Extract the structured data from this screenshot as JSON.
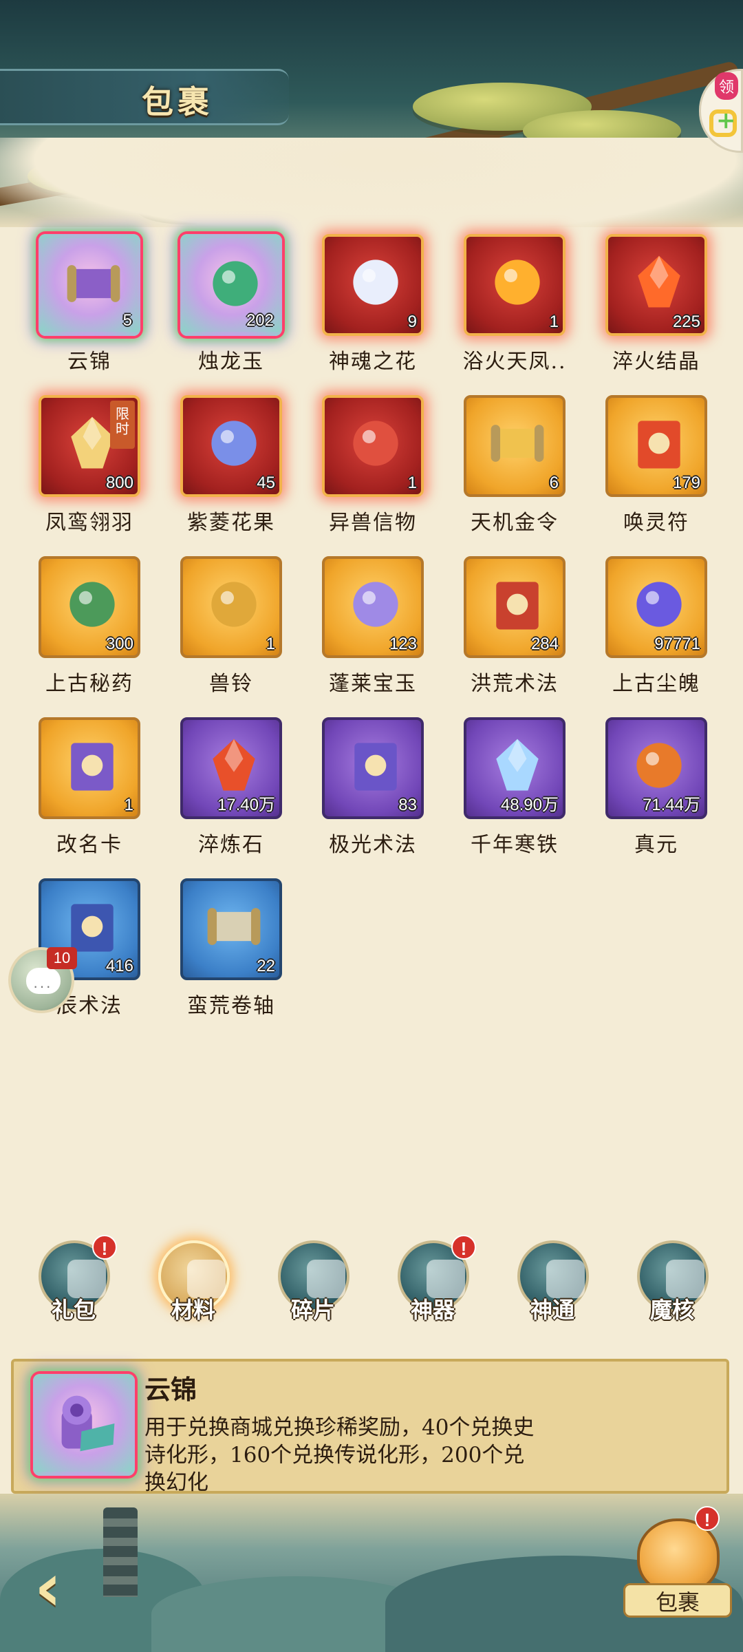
{
  "header": {
    "title": "包裹",
    "gift_label": "领"
  },
  "items": [
    {
      "name": "云锦",
      "count": "5",
      "rarity": "rainbow",
      "icon": "cloud-brocade-icon",
      "color": "#8b5fc7"
    },
    {
      "name": "烛龙玉",
      "count": "202",
      "rarity": "rainbow",
      "icon": "dragon-jade-icon",
      "color": "#3fae7a"
    },
    {
      "name": "神魂之花",
      "count": "9",
      "rarity": "red",
      "icon": "soul-flower-icon",
      "color": "#e9eefc"
    },
    {
      "name": "浴火天凤..",
      "count": "1",
      "rarity": "red",
      "icon": "fire-phoenix-icon",
      "color": "#ffb02e"
    },
    {
      "name": "淬火结晶",
      "count": "225",
      "rarity": "red",
      "icon": "quench-crystal-icon",
      "color": "#ff6a2a"
    },
    {
      "name": "凤鸾翎羽",
      "count": "800",
      "rarity": "red",
      "icon": "phoenix-feather-icon",
      "color": "#f3d27a",
      "limited": "限时"
    },
    {
      "name": "紫菱花果",
      "count": "45",
      "rarity": "red",
      "icon": "purple-fruit-icon",
      "color": "#7a8fe8"
    },
    {
      "name": "异兽信物",
      "count": "1",
      "rarity": "red",
      "icon": "beast-token-icon",
      "color": "#e0503f"
    },
    {
      "name": "天机金令",
      "count": "6",
      "rarity": "orange",
      "icon": "golden-order-icon",
      "color": "#f0c24e"
    },
    {
      "name": "唤灵符",
      "count": "179",
      "rarity": "orange",
      "icon": "spirit-talisman-icon",
      "color": "#e24a2a"
    },
    {
      "name": "上古秘药",
      "count": "300",
      "rarity": "orange",
      "icon": "ancient-medicine-icon",
      "color": "#4c9a5a"
    },
    {
      "name": "兽铃",
      "count": "1",
      "rarity": "orange",
      "icon": "beast-bell-icon",
      "color": "#e0a83a"
    },
    {
      "name": "蓬莱宝玉",
      "count": "123",
      "rarity": "orange",
      "icon": "penglai-jade-icon",
      "color": "#9f8ae6"
    },
    {
      "name": "洪荒术法",
      "count": "284",
      "rarity": "orange",
      "icon": "primal-spellbook-icon",
      "color": "#c9412e"
    },
    {
      "name": "上古尘魄",
      "count": "97771",
      "rarity": "orange",
      "icon": "dust-soul-orb-icon",
      "color": "#6a5ae0"
    },
    {
      "name": "改名卡",
      "count": "1",
      "rarity": "orange",
      "icon": "rename-card-icon",
      "color": "#7b5ac8"
    },
    {
      "name": "淬炼石",
      "count": "17.40万",
      "rarity": "purple",
      "icon": "refining-stone-icon",
      "color": "#e8502a"
    },
    {
      "name": "极光术法",
      "count": "83",
      "rarity": "purple",
      "icon": "aurora-spellbook-icon",
      "color": "#6a55c8"
    },
    {
      "name": "千年寒铁",
      "count": "48.90万",
      "rarity": "purple",
      "icon": "cold-iron-icon",
      "color": "#a9d8ff"
    },
    {
      "name": "真元",
      "count": "71.44万",
      "rarity": "purple",
      "icon": "true-essence-orb-icon",
      "color": "#e87a2a"
    },
    {
      "name": "辰术法",
      "count": "416",
      "rarity": "blue",
      "icon": "star-spellbook-icon",
      "color": "#3d56b0"
    },
    {
      "name": "蛮荒卷轴",
      "count": "22",
      "rarity": "blue",
      "icon": "wild-scroll-icon",
      "color": "#d9d0b4"
    }
  ],
  "chat": {
    "badge": "10",
    "dots": "···"
  },
  "tabs": [
    {
      "label": "礼包",
      "alert": "!",
      "active": false
    },
    {
      "label": "材料",
      "alert": "",
      "active": true
    },
    {
      "label": "碎片",
      "alert": "",
      "active": false
    },
    {
      "label": "神器",
      "alert": "!",
      "active": false
    },
    {
      "label": "神通",
      "alert": "",
      "active": false
    },
    {
      "label": "魔核",
      "alert": "",
      "active": false
    }
  ],
  "detail": {
    "name": "云锦",
    "description": "用于兑换商城兑换珍稀奖励，40个兑换史诗化形，160个兑换传说化形，200个兑换幻化"
  },
  "bottom": {
    "back_arrow": "‹",
    "bag_label": "包裹",
    "bag_alert": "!"
  }
}
